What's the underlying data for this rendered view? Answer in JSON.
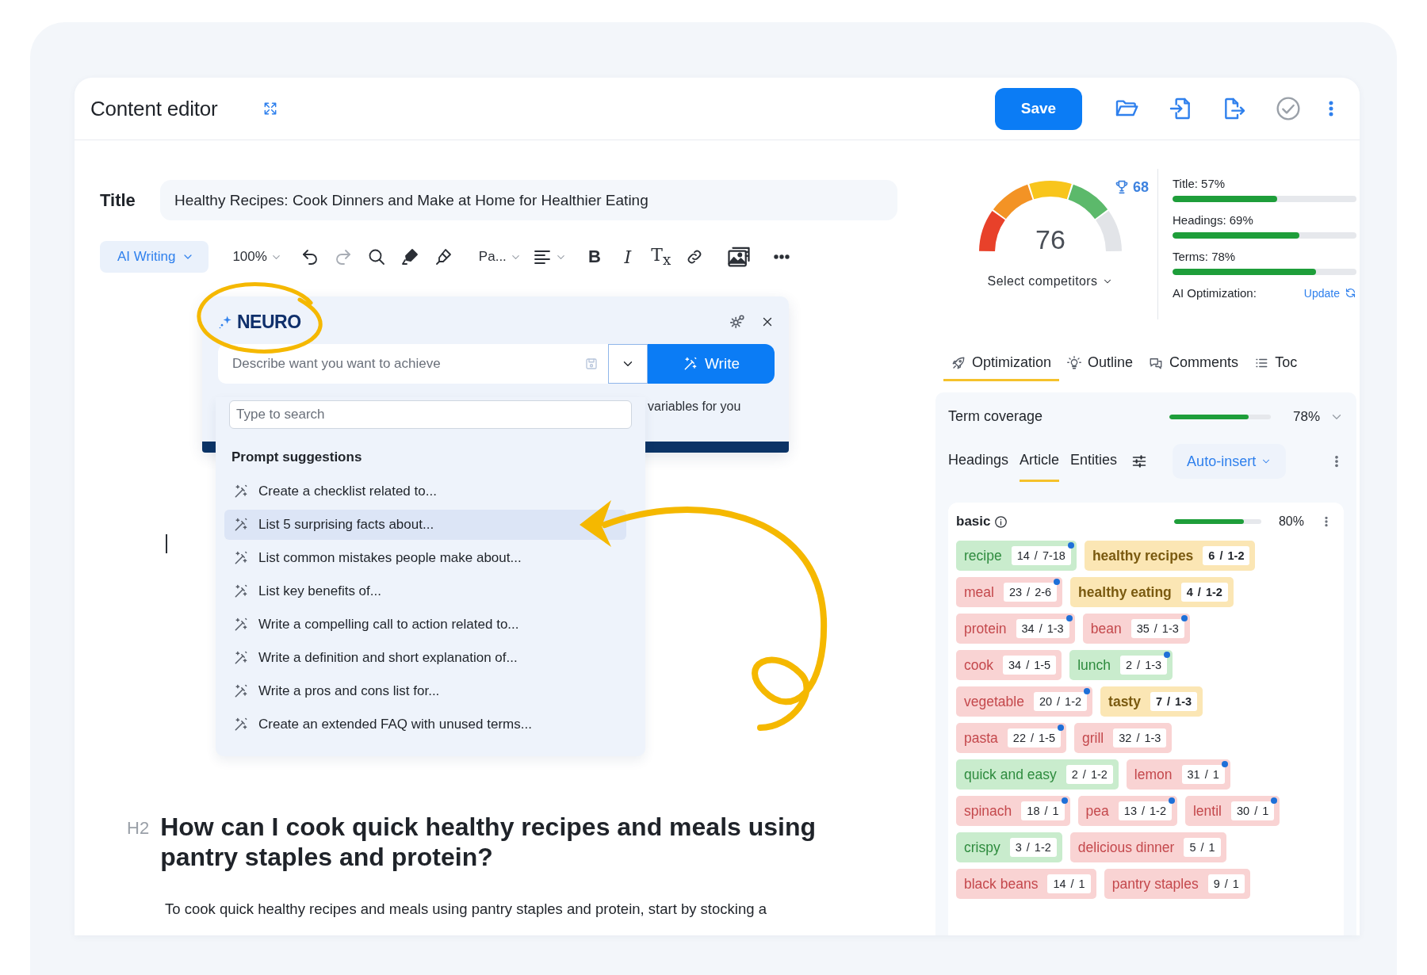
{
  "header": {
    "title": "Content editor",
    "save": "Save"
  },
  "title_field": {
    "label": "Title",
    "value": "Healthy Recipes: Cook Dinners and Make at Home for Healthier Eating"
  },
  "toolbar": {
    "ai_writing": "AI Writing",
    "zoom": "100%",
    "paragraph": "Pa...",
    "bold": "B",
    "italic": "I",
    "clear_format": "T$_{x}$",
    "redo_disabled": true
  },
  "neuro": {
    "logo": "NEURO",
    "prompt_placeholder": "Describe want you want to achieve",
    "write": "Write",
    "hint": "variables for you",
    "search_placeholder": "Type to search",
    "suggestions_title": "Prompt suggestions",
    "suggestions": [
      {
        "label": "Create a checklist related to...",
        "selected": false
      },
      {
        "label": "List 5 surprising facts about...",
        "selected": true
      },
      {
        "label": "List common mistakes people make about...",
        "selected": false
      },
      {
        "label": "List key benefits of...",
        "selected": false
      },
      {
        "label": "Write a compelling call to action related to...",
        "selected": false
      },
      {
        "label": "Write a definition and short explanation of...",
        "selected": false
      },
      {
        "label": "Write a pros and cons list for...",
        "selected": false
      },
      {
        "label": "Create an extended FAQ with unused terms...",
        "selected": false
      }
    ]
  },
  "document": {
    "heading_level": "H2",
    "heading": "How can I cook quick healthy recipes and meals using pantry staples and protein?",
    "paragraph": "To cook quick healthy recipes and meals using pantry staples and protein, start by stocking a"
  },
  "score": {
    "value": "76",
    "level": 0.76,
    "benchmark": "68",
    "competitors": "Select competitors"
  },
  "metrics": [
    {
      "label": "Title: 57%",
      "level": 0.57
    },
    {
      "label": "Headings: 69%",
      "level": 0.69
    },
    {
      "label": "Terms: 78%",
      "level": 0.78
    }
  ],
  "ai_optimization": {
    "label": "AI Optimization:",
    "action": "Update"
  },
  "tabs": [
    {
      "label": "Optimization",
      "selected": true
    },
    {
      "label": "Outline",
      "selected": false
    },
    {
      "label": "Comments",
      "selected": false
    },
    {
      "label": "Toc",
      "selected": false
    }
  ],
  "term_coverage": {
    "label": "Term coverage",
    "level": 0.78,
    "value": "78%"
  },
  "term_tabs": [
    {
      "label": "Headings",
      "selected": false
    },
    {
      "label": "Article",
      "selected": true
    },
    {
      "label": "Entities",
      "selected": false
    }
  ],
  "auto_insert": "Auto-insert",
  "group": {
    "name": "basic",
    "level": 0.8,
    "value": "80%",
    "terms": [
      {
        "term": "recipe",
        "count": "14 / 7-18",
        "color": "#c9eccd",
        "dot": true
      },
      {
        "term": "healthy recipes",
        "count": "6 / 1-2",
        "color": "#fbe6b4",
        "dot": false
      },
      {
        "term": "meal",
        "count": "23 / 2-6",
        "color": "#f9d3d3",
        "dot": true
      },
      {
        "term": "healthy eating",
        "count": "4 / 1-2",
        "color": "#fbe6b4",
        "dot": false
      },
      {
        "term": "protein",
        "count": "34 / 1-3",
        "color": "#f9d3d3",
        "dot": true
      },
      {
        "term": "bean",
        "count": "35 / 1-3",
        "color": "#f9d3d3",
        "dot": true
      },
      {
        "term": "cook",
        "count": "34 / 1-5",
        "color": "#f9d3d3",
        "dot": false
      },
      {
        "term": "lunch",
        "count": "2 / 1-3",
        "color": "#c9eccd",
        "dot": true
      },
      {
        "term": "vegetable",
        "count": "20 / 1-2",
        "color": "#f9d3d3",
        "dot": true
      },
      {
        "term": "tasty",
        "count": "7 / 1-3",
        "color": "#fbe6b4",
        "dot": false
      },
      {
        "term": "pasta",
        "count": "22 / 1-5",
        "color": "#f9d3d3",
        "dot": true
      },
      {
        "term": "grill",
        "count": "32 / 1-3",
        "color": "#f9d3d3",
        "dot": false
      },
      {
        "term": "quick and easy",
        "count": "2 / 1-2",
        "color": "#c9eccd",
        "dot": false
      },
      {
        "term": "lemon",
        "count": "31 / 1",
        "color": "#f9d3d3",
        "dot": true
      },
      {
        "term": "spinach",
        "count": "18 / 1",
        "color": "#f9d3d3",
        "dot": true
      },
      {
        "term": "pea",
        "count": "13 / 1-2",
        "color": "#f9d3d3",
        "dot": true
      },
      {
        "term": "lentil",
        "count": "30 / 1",
        "color": "#f9d3d3",
        "dot": true
      },
      {
        "term": "crispy",
        "count": "3 / 1-2",
        "color": "#c9eccd",
        "dot": false
      },
      {
        "term": "delicious dinner",
        "count": "5 / 1",
        "color": "#f9d3d3",
        "dot": false
      },
      {
        "term": "black beans",
        "count": "14 / 1",
        "color": "#f9d3d3",
        "dot": false
      },
      {
        "term": "pantry staples",
        "count": "9 / 1",
        "color": "#f9d3d3",
        "dot": false
      }
    ]
  }
}
